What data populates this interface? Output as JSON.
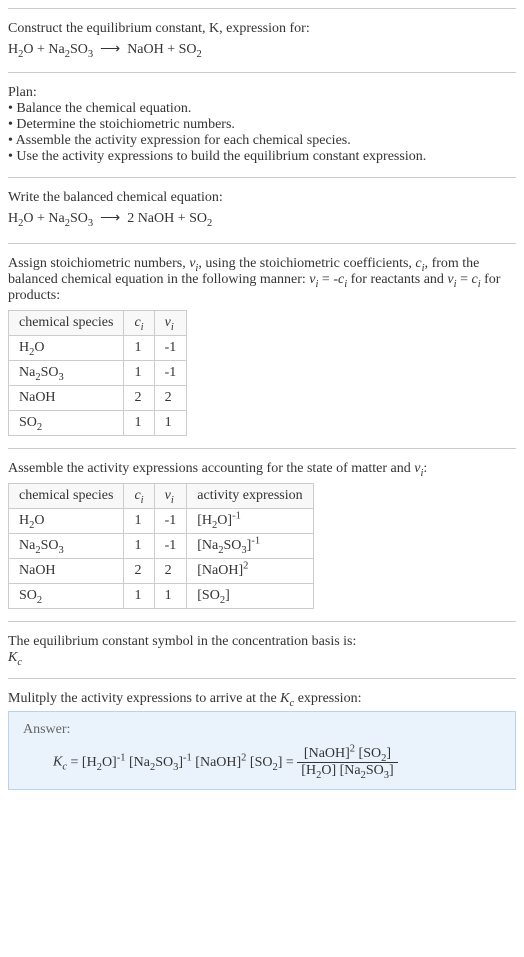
{
  "title": "Construct the equilibrium constant, K, expression for:",
  "unbalanced": "H₂O + Na₂SO₃ ⟶ NaOH + SO₂",
  "plan_heading": "Plan:",
  "plan_items": [
    "Balance the chemical equation.",
    "Determine the stoichiometric numbers.",
    "Assemble the activity expression for each chemical species.",
    "Use the activity expressions to build the equilibrium constant expression."
  ],
  "balanced_heading": "Write the balanced chemical equation:",
  "balanced": "H₂O + Na₂SO₃ ⟶ 2 NaOH + SO₂",
  "assign_text_a": "Assign stoichiometric numbers, ",
  "assign_text_b": ", using the stoichiometric coefficients, ",
  "assign_text_c": ", from the balanced chemical equation in the following manner: ",
  "assign_text_d": " for reactants and ",
  "assign_text_e": " for products:",
  "table1_headers": [
    "chemical species",
    "cᵢ",
    "νᵢ"
  ],
  "table1_rows": [
    [
      "H₂O",
      "1",
      "-1"
    ],
    [
      "Na₂SO₃",
      "1",
      "-1"
    ],
    [
      "NaOH",
      "2",
      "2"
    ],
    [
      "SO₂",
      "1",
      "1"
    ]
  ],
  "assemble_text": "Assemble the activity expressions accounting for the state of matter and νᵢ:",
  "table2_headers": [
    "chemical species",
    "cᵢ",
    "νᵢ",
    "activity expression"
  ],
  "table2_rows": [
    [
      "H₂O",
      "1",
      "-1",
      "[H₂O]⁻¹"
    ],
    [
      "Na₂SO₃",
      "1",
      "-1",
      "[Na₂SO₃]⁻¹"
    ],
    [
      "NaOH",
      "2",
      "2",
      "[NaOH]²"
    ],
    [
      "SO₂",
      "1",
      "1",
      "[SO₂]"
    ]
  ],
  "symbol_text": "The equilibrium constant symbol in the concentration basis is:",
  "kc_symbol": "K_c",
  "multiply_text": "Mulitply the activity expressions to arrive at the K_c expression:",
  "answer_label": "Answer:",
  "kc_lhs": "K_c = [H₂O]⁻¹ [Na₂SO₃]⁻¹ [NaOH]² [SO₂] =",
  "kc_num": "[NaOH]² [SO₂]",
  "kc_den": "[H₂O] [Na₂SO₃]"
}
